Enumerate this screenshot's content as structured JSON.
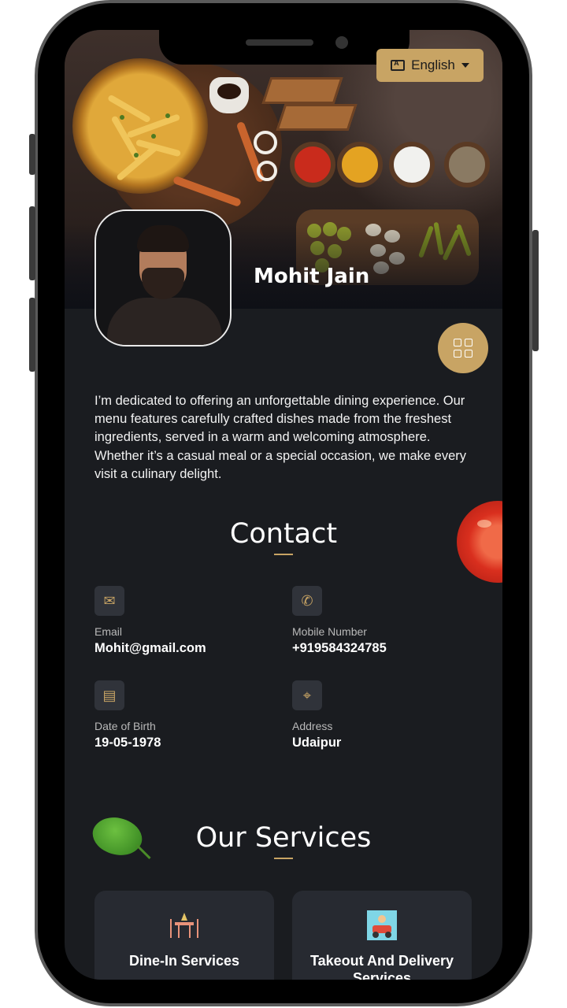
{
  "header": {
    "language_label": "English",
    "profile_name": "Mohit Jain"
  },
  "about": {
    "text": "I’m dedicated to offering an unforgettable dining experience. Our menu features carefully crafted dishes made from the freshest ingredients, served in a warm and welcoming atmosphere. Whether it’s a casual meal or a special occasion, we make every visit a culinary delight."
  },
  "contact": {
    "title": "Contact",
    "items": [
      {
        "label": "Email",
        "value": "Mohit@gmail.com",
        "icon": "mail-icon"
      },
      {
        "label": "Mobile Number",
        "value": "+919584324785",
        "icon": "phone-icon"
      },
      {
        "label": "Date of Birth",
        "value": "19-05-1978",
        "icon": "cake-icon"
      },
      {
        "label": "Address",
        "value": "Udaipur",
        "icon": "location-pin-icon"
      }
    ]
  },
  "services": {
    "title": "Our Services",
    "items": [
      {
        "title": "Dine-In Services",
        "icon": "dining-table-icon"
      },
      {
        "title": "Takeout And Delivery Services",
        "icon": "delivery-icon"
      }
    ]
  },
  "colors": {
    "accent": "#c8a464",
    "background": "#1a1c20",
    "card": "#272a31"
  }
}
